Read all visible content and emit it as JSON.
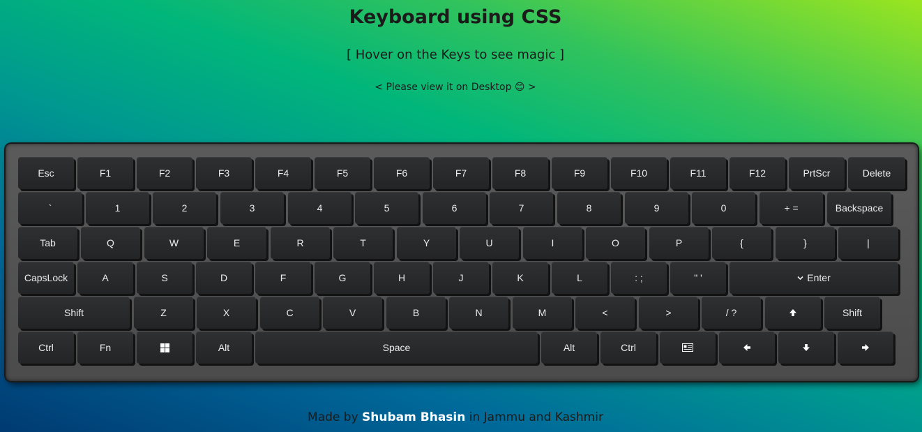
{
  "header": {
    "title": "Keyboard using CSS",
    "subtitle": "[ Hover on the Keys to see magic ]",
    "note_prefix": "< Please view it on Desktop ",
    "note_emoji": "😊",
    "note_suffix": " >"
  },
  "keyboard": {
    "row1": [
      "Esc",
      "F1",
      "F2",
      "F3",
      "F4",
      "F5",
      "F6",
      "F7",
      "F8",
      "F9",
      "F10",
      "F11",
      "F12",
      "PrtScr",
      "Delete"
    ],
    "row2": [
      "`",
      "1",
      "2",
      "3",
      "4",
      "5",
      "6",
      "7",
      "8",
      "9",
      "0",
      "+ =",
      "Backspace"
    ],
    "row3": [
      "Tab",
      "Q",
      "W",
      "E",
      "R",
      "T",
      "Y",
      "U",
      "I",
      "O",
      "P",
      "{",
      "}",
      "|"
    ],
    "row4": [
      "CapsLock",
      "A",
      "S",
      "D",
      "F",
      "G",
      "H",
      "J",
      "K",
      "L",
      ": ;",
      "\" '",
      "Enter"
    ],
    "row5": [
      "Shift",
      "Z",
      "X",
      "C",
      "V",
      "B",
      "N",
      "M",
      "<",
      ">",
      "/ ?",
      "Shift"
    ],
    "row6": [
      "Ctrl",
      "Fn",
      "Alt",
      "Space",
      "Alt",
      "Ctrl"
    ],
    "icons": {
      "enter": "chevron-down-icon",
      "up": "arrow-up-icon",
      "windows": "windows-icon",
      "menu": "context-menu-icon",
      "left": "arrow-left-icon",
      "down": "arrow-down-icon",
      "right": "arrow-right-icon"
    }
  },
  "footer": {
    "prefix": "Made by ",
    "author": "Shubam Bhasin",
    "suffix": " in Jammu and Kashmir"
  }
}
